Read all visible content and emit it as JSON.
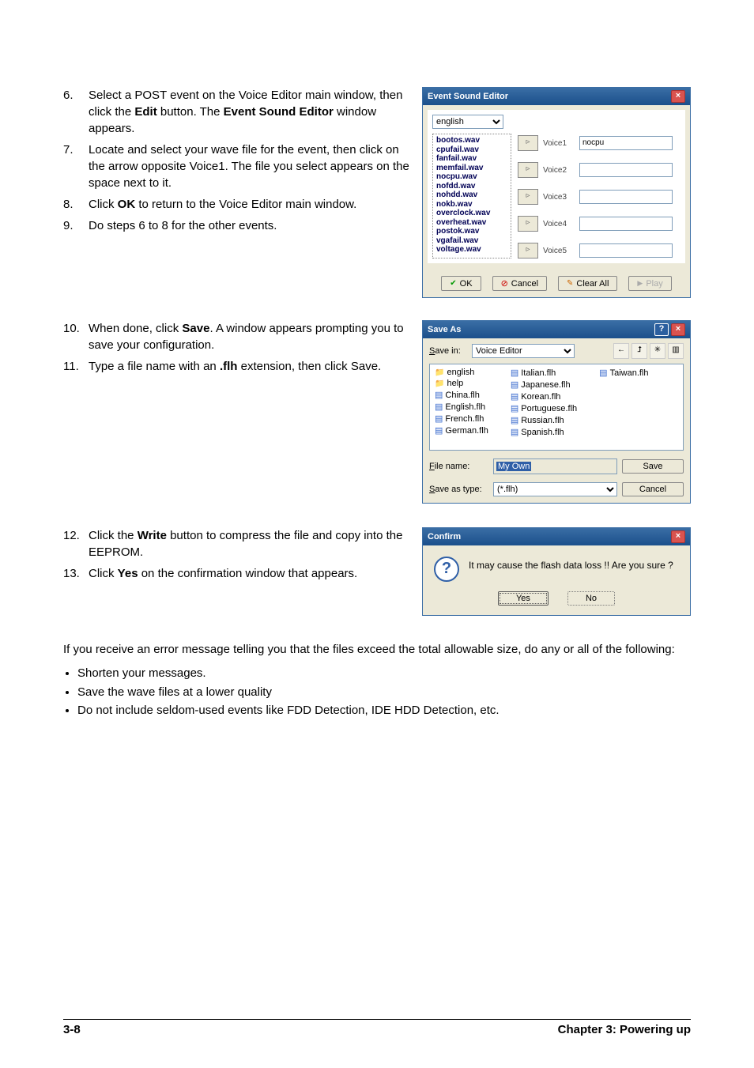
{
  "steps_a": [
    {
      "num": "6.",
      "html": "Select a POST event on the Voice Editor main window, then click the <b>Edit</b> button. The <b>Event Sound Editor</b> window appears."
    },
    {
      "num": "7.",
      "html": "Locate and select your wave file for the event, then click on the arrow opposite Voice1. The file you select appears on the space next to it."
    },
    {
      "num": "8.",
      "html": "Click <b>OK</b> to return to the Voice Editor main window."
    },
    {
      "num": "9.",
      "html": "Do steps 6 to 8 for the other events."
    }
  ],
  "steps_b": [
    {
      "num": "10.",
      "html": "When done, click <b>Save</b>. A window appears prompting you to save your configuration."
    },
    {
      "num": "11.",
      "html": "Type a file name with an <b>.flh</b> extension, then click Save."
    }
  ],
  "steps_c": [
    {
      "num": "12.",
      "html": "Click the <b>Write</b> button to compress the file and copy into the EEPROM."
    },
    {
      "num": "13.",
      "html": "Click <b>Yes</b> on the confirmation window that appears."
    }
  ],
  "para_error": "If you receive an error message telling you that the files exceed the total allowable size, do any or all of the following:",
  "bullets": [
    "Shorten your messages.",
    "Save the wave files at a lower quality",
    "Do not include seldom-used events like FDD Detection, IDE HDD Detection, etc."
  ],
  "footer": {
    "left": "3-8",
    "right": "Chapter 3: Powering up"
  },
  "ese": {
    "title": "Event Sound Editor",
    "lang_options": [
      "english"
    ],
    "wav_files": [
      "bootos.wav",
      "cpufail.wav",
      "fanfail.wav",
      "memfail.wav",
      "nocpu.wav",
      "nofdd.wav",
      "nohdd.wav",
      "nokb.wav",
      "overclock.wav",
      "overheat.wav",
      "postok.wav",
      "vgafail.wav",
      "voltage.wav"
    ],
    "voices": [
      {
        "label": "Voice1",
        "value": "nocpu"
      },
      {
        "label": "Voice2",
        "value": ""
      },
      {
        "label": "Voice3",
        "value": ""
      },
      {
        "label": "Voice4",
        "value": ""
      },
      {
        "label": "Voice5",
        "value": ""
      }
    ],
    "buttons": {
      "ok": "OK",
      "cancel": "Cancel",
      "clear": "Clear All",
      "play": "Play"
    }
  },
  "saveas": {
    "title": "Save As",
    "save_in_label": "Save in:",
    "save_in_value": "Voice Editor",
    "files_col1": [
      {
        "type": "folder",
        "name": "english"
      },
      {
        "type": "folder",
        "name": "help"
      },
      {
        "type": "flh",
        "name": "China.flh"
      },
      {
        "type": "flh",
        "name": "English.flh"
      },
      {
        "type": "flh",
        "name": "French.flh"
      },
      {
        "type": "flh",
        "name": "German.flh"
      }
    ],
    "files_col2": [
      {
        "type": "flh",
        "name": "Italian.flh"
      },
      {
        "type": "flh",
        "name": "Japanese.flh"
      },
      {
        "type": "flh",
        "name": "Korean.flh"
      },
      {
        "type": "flh",
        "name": "Portuguese.flh"
      },
      {
        "type": "flh",
        "name": "Russian.flh"
      },
      {
        "type": "flh",
        "name": "Spanish.flh"
      }
    ],
    "files_col3": [
      {
        "type": "flh",
        "name": "Taiwan.flh"
      }
    ],
    "filename_label": "File name:",
    "filename_value": "My Own",
    "saveastype_label": "Save as type:",
    "saveastype_value": "(*.flh)",
    "save_btn": "Save",
    "cancel_btn": "Cancel"
  },
  "confirm": {
    "title": "Confirm",
    "message": "It may cause the flash data loss !!  Are you sure ?",
    "yes": "Yes",
    "no": "No"
  }
}
